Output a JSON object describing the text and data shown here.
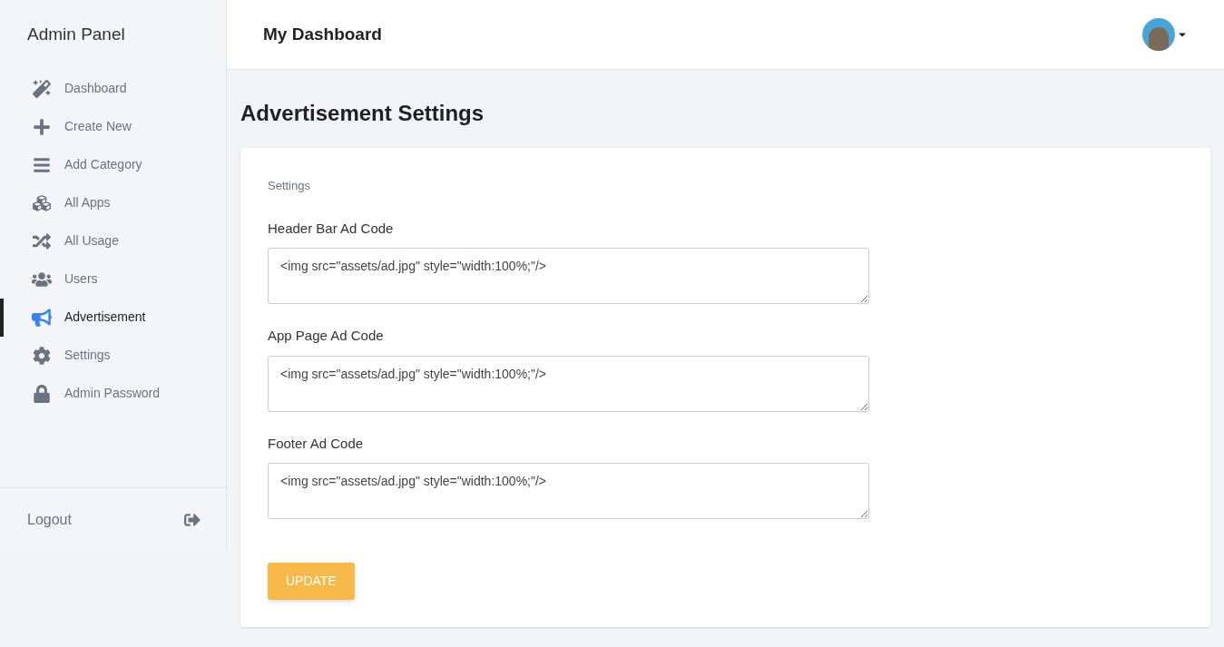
{
  "sidebar": {
    "title": "Admin Panel",
    "items": [
      {
        "label": "Dashboard",
        "selected": false
      },
      {
        "label": "Create New",
        "selected": false
      },
      {
        "label": "Add Category",
        "selected": false
      },
      {
        "label": "All Apps",
        "selected": false
      },
      {
        "label": "All Usage",
        "selected": false
      },
      {
        "label": "Users",
        "selected": false
      },
      {
        "label": "Advertisement",
        "selected": true
      },
      {
        "label": "Settings",
        "selected": false
      },
      {
        "label": "Admin Password",
        "selected": false
      }
    ],
    "logout": "Logout"
  },
  "header": {
    "title": "My Dashboard"
  },
  "page": {
    "title": "Advertisement Settings",
    "section": "Settings",
    "fields": [
      {
        "label": "Header Bar Ad Code",
        "value": "<img src=\"assets/ad.jpg\" style=\"width:100%;\"/>"
      },
      {
        "label": "App Page Ad Code",
        "value": "<img src=\"assets/ad.jpg\" style=\"width:100%;\"/>"
      },
      {
        "label": "Footer Ad Code",
        "value": "<img src=\"assets/ad.jpg\" style=\"width:100%;\"/>"
      }
    ],
    "button": "UPDATE"
  }
}
